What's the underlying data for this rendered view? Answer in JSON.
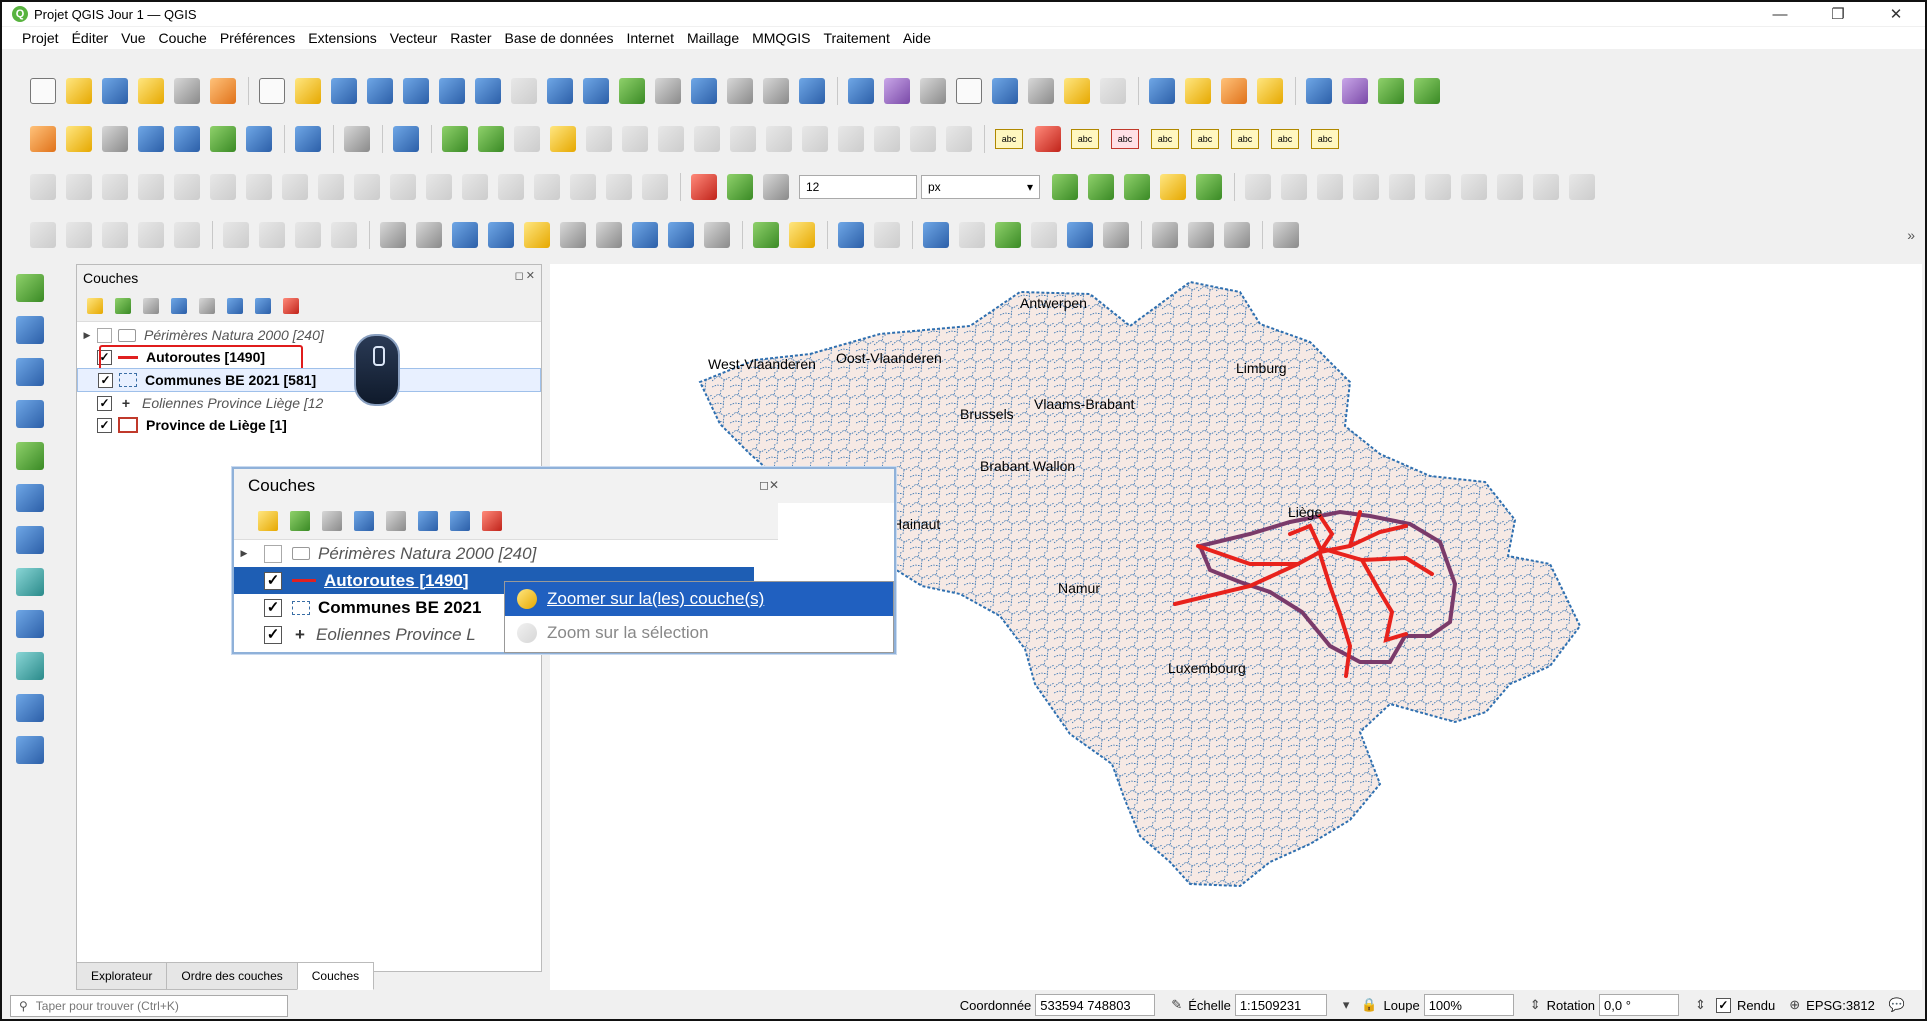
{
  "window": {
    "title": "Projet QGIS Jour 1 — QGIS",
    "controls": {
      "minimize": "—",
      "restore": "❐",
      "close": "✕"
    }
  },
  "menu": [
    "Projet",
    "Éditer",
    "Vue",
    "Couche",
    "Préférences",
    "Extensions",
    "Vecteur",
    "Raster",
    "Base de données",
    "Internet",
    "Maillage",
    "MMQGIS",
    "Traitement",
    "Aide"
  ],
  "toolbar": {
    "snapping_tolerance": "12",
    "snapping_unit": "px",
    "label_tool_text": "abc"
  },
  "layers_panel": {
    "title": "Couches",
    "layers": [
      {
        "name": "Périmères Natura 2000 [240]",
        "checked": false
      },
      {
        "name": "Autoroutes [1490]",
        "checked": true
      },
      {
        "name": "Communes BE 2021 [581]",
        "checked": true
      },
      {
        "name": "Eoliennes Province Liège [12",
        "checked": true
      },
      {
        "name": "Province de Liège [1]",
        "checked": true
      }
    ],
    "tabs": [
      "Explorateur",
      "Ordre des couches",
      "Couches"
    ],
    "active_tab": "Couches"
  },
  "inset": {
    "title": "Couches",
    "layers": [
      {
        "name": "Périmères Natura 2000 [240]",
        "checked": false
      },
      {
        "name": "Autoroutes [1490]",
        "checked": true
      },
      {
        "name": "Communes BE 2021",
        "checked": true
      },
      {
        "name": "Eoliennes Province L",
        "checked": true
      }
    ],
    "context_menu": [
      {
        "label": "Zoomer sur la(les) couche(s)",
        "enabled": true
      },
      {
        "label": "Zoom sur la sélection",
        "enabled": false
      }
    ]
  },
  "map": {
    "labels": [
      "Antwerpen",
      "West-Vlaanderen",
      "Oost-Vlaanderen",
      "Limburg",
      "Brussels",
      "Vlaams-Brabant",
      "Brabant Wallon",
      "Liège",
      "Hainaut",
      "Namur",
      "Luxembourg"
    ],
    "colors": {
      "communes_fill": "#f6e9e4",
      "communes_border": "#2e6fb0",
      "autoroutes": "#e8221c",
      "province": "#7a3a6a"
    }
  },
  "statusbar": {
    "search_placeholder": "Taper pour trouver (Ctrl+K)",
    "coord_label": "Coordonnée",
    "coord_value": "533594  748803",
    "scale_label": "Échelle",
    "scale_value": "1:1509231",
    "magnifier_label": "Loupe",
    "magnifier_value": "100%",
    "rotation_label": "Rotation",
    "rotation_value": "0,0 °",
    "render_label": "Rendu",
    "crs": "EPSG:3812"
  }
}
